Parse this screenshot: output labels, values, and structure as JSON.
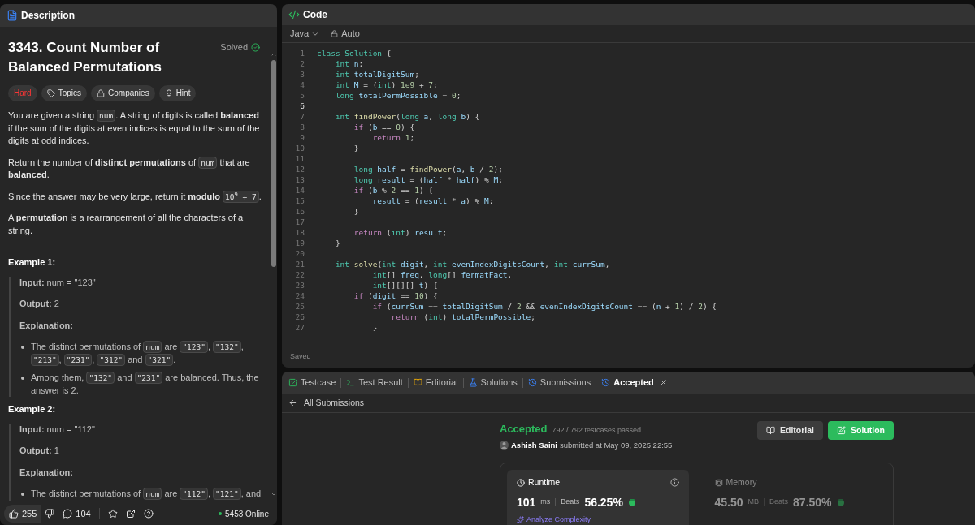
{
  "description": {
    "tab": "Description",
    "title": "3343. Count Number of Balanced Permutations",
    "status": "Solved",
    "solved": true,
    "tags": [
      {
        "label": "Hard",
        "kind": "difficulty"
      },
      {
        "label": "Topics",
        "kind": "topics"
      },
      {
        "label": "Companies",
        "kind": "companies"
      },
      {
        "label": "Hint",
        "kind": "hint"
      }
    ],
    "paragraphs": [
      [
        {
          "t": "You are given a string ",
          "kind": "text"
        },
        {
          "t": "num",
          "kind": "code"
        },
        {
          "t": ". A string of digits is called **balanced** if the sum of the digits at even indices is equal to the sum of the digits at odd indices.",
          "kind": "text"
        }
      ],
      [
        {
          "t": "Return the number of **distinct permutations** of ",
          "kind": "text"
        },
        {
          "t": "num",
          "kind": "code"
        },
        {
          "t": " that are **balanced**.",
          "kind": "text"
        }
      ],
      [
        {
          "t": "Since the answer may be very large, return it **modulo** ",
          "kind": "text"
        },
        {
          "t": "10$^{9}$ + 7",
          "kind": "code"
        },
        {
          "t": ".",
          "kind": "text"
        }
      ],
      [
        {
          "t": "A **permutation** is a rearrangement of all the characters of a string.",
          "kind": "text"
        }
      ]
    ],
    "examples": [
      {
        "heading": "Example 1:",
        "input": "**Input:** num = \"123\"",
        "output": "**Output:** 2",
        "explanation": "Explanation:",
        "bullets": [
          [
            {
              "t": "The distinct permutations of ",
              "kind": "text"
            },
            {
              "t": "num",
              "kind": "code"
            },
            {
              "t": " are ",
              "kind": "text"
            },
            {
              "t": "\"123\"",
              "kind": "code"
            },
            {
              "t": ", ",
              "kind": "text"
            },
            {
              "t": "\"132\"",
              "kind": "code"
            },
            {
              "t": ", ",
              "kind": "text"
            },
            {
              "t": "\"213\"",
              "kind": "code"
            },
            {
              "t": ", ",
              "kind": "text"
            },
            {
              "t": "\"231\"",
              "kind": "code"
            },
            {
              "t": ", ",
              "kind": "text"
            },
            {
              "t": "\"312\"",
              "kind": "code"
            },
            {
              "t": " and ",
              "kind": "text"
            },
            {
              "t": "\"321\"",
              "kind": "code"
            },
            {
              "t": ".",
              "kind": "text"
            }
          ],
          [
            {
              "t": "Among them, ",
              "kind": "text"
            },
            {
              "t": "\"132\"",
              "kind": "code"
            },
            {
              "t": " and ",
              "kind": "text"
            },
            {
              "t": "\"231\"",
              "kind": "code"
            },
            {
              "t": " are balanced. Thus, the answer is 2.",
              "kind": "text"
            }
          ]
        ]
      },
      {
        "heading": "Example 2:",
        "input": "**Input:** num = \"112\"",
        "output": "**Output:** 1",
        "explanation": "Explanation:",
        "bullets": [
          [
            {
              "t": "The distinct permutations of ",
              "kind": "text"
            },
            {
              "t": "num",
              "kind": "code"
            },
            {
              "t": " are ",
              "kind": "text"
            },
            {
              "t": "\"112\"",
              "kind": "code"
            },
            {
              "t": ", ",
              "kind": "text"
            },
            {
              "t": "\"121\"",
              "kind": "code"
            },
            {
              "t": ", and",
              "kind": "text"
            }
          ]
        ]
      }
    ],
    "footer": {
      "likes": "255",
      "comments": "104",
      "online": "5453 Online"
    }
  },
  "code": {
    "tab": "Code",
    "language": "Java",
    "mode": "Auto",
    "status": "Saved",
    "lines": [
      {
        "number": "1",
        "active": false,
        "tokens": [
          {
            "t": "class ",
            "kind": "kw"
          },
          {
            "t": "Solution",
            "kind": "cls"
          },
          {
            "t": " {",
            "kind": "p"
          }
        ]
      },
      {
        "number": "2",
        "active": false,
        "tokens": [
          {
            "t": "    int ",
            "kind": "kw"
          },
          {
            "t": "n",
            "kind": "var"
          },
          {
            "t": ";",
            "kind": "p"
          }
        ]
      },
      {
        "number": "3",
        "active": false,
        "tokens": [
          {
            "t": "    int ",
            "kind": "kw"
          },
          {
            "t": "totalDigitSum",
            "kind": "var"
          },
          {
            "t": ";",
            "kind": "p"
          }
        ]
      },
      {
        "number": "4",
        "active": false,
        "tokens": [
          {
            "t": "    int ",
            "kind": "kw"
          },
          {
            "t": "M",
            "kind": "var"
          },
          {
            "t": " = (",
            "kind": "p"
          },
          {
            "t": "int",
            "kind": "kw"
          },
          {
            "t": ") ",
            "kind": "p"
          },
          {
            "t": "1e9",
            "kind": "num"
          },
          {
            "t": " + ",
            "kind": "p"
          },
          {
            "t": "7",
            "kind": "num"
          },
          {
            "t": ";",
            "kind": "p"
          }
        ]
      },
      {
        "number": "5",
        "active": false,
        "tokens": [
          {
            "t": "    long ",
            "kind": "kw"
          },
          {
            "t": "totalPermPossible",
            "kind": "var"
          },
          {
            "t": " = ",
            "kind": "p"
          },
          {
            "t": "0",
            "kind": "num"
          },
          {
            "t": ";",
            "kind": "p"
          }
        ]
      },
      {
        "number": "6",
        "active": true
      },
      {
        "number": "7",
        "active": false,
        "tokens": [
          {
            "t": "    int ",
            "kind": "kw"
          },
          {
            "t": "findPower",
            "kind": "fn"
          },
          {
            "t": "(",
            "kind": "p"
          },
          {
            "t": "long ",
            "kind": "kw"
          },
          {
            "t": "a",
            "kind": "var"
          },
          {
            "t": ", ",
            "kind": "p"
          },
          {
            "t": "long ",
            "kind": "kw"
          },
          {
            "t": "b",
            "kind": "var"
          },
          {
            "t": ") {",
            "kind": "p"
          }
        ]
      },
      {
        "number": "8",
        "active": false,
        "tokens": [
          {
            "t": "        if ",
            "kind": "ctrl"
          },
          {
            "t": "(",
            "kind": "p"
          },
          {
            "t": "b",
            "kind": "var"
          },
          {
            "t": " == ",
            "kind": "p"
          },
          {
            "t": "0",
            "kind": "num"
          },
          {
            "t": ") {",
            "kind": "p"
          }
        ]
      },
      {
        "number": "9",
        "active": false,
        "tokens": [
          {
            "t": "            return ",
            "kind": "ctrl"
          },
          {
            "t": "1",
            "kind": "num"
          },
          {
            "t": ";",
            "kind": "p"
          }
        ]
      },
      {
        "number": "10",
        "active": false,
        "tokens": [
          {
            "t": "        }",
            "kind": "p"
          }
        ]
      },
      {
        "number": "11",
        "active": false
      },
      {
        "number": "12",
        "active": false,
        "tokens": [
          {
            "t": "        long ",
            "kind": "kw"
          },
          {
            "t": "half",
            "kind": "var"
          },
          {
            "t": " = ",
            "kind": "p"
          },
          {
            "t": "findPower",
            "kind": "fn"
          },
          {
            "t": "(",
            "kind": "p"
          },
          {
            "t": "a",
            "kind": "var"
          },
          {
            "t": ", ",
            "kind": "p"
          },
          {
            "t": "b",
            "kind": "var"
          },
          {
            "t": " / ",
            "kind": "p"
          },
          {
            "t": "2",
            "kind": "num"
          },
          {
            "t": ");",
            "kind": "p"
          }
        ]
      },
      {
        "number": "13",
        "active": false,
        "tokens": [
          {
            "t": "        long ",
            "kind": "kw"
          },
          {
            "t": "result",
            "kind": "var"
          },
          {
            "t": " = (",
            "kind": "p"
          },
          {
            "t": "half",
            "kind": "var"
          },
          {
            "t": " * ",
            "kind": "p"
          },
          {
            "t": "half",
            "kind": "var"
          },
          {
            "t": ") % ",
            "kind": "p"
          },
          {
            "t": "M",
            "kind": "var"
          },
          {
            "t": ";",
            "kind": "p"
          }
        ]
      },
      {
        "number": "14",
        "active": false,
        "tokens": [
          {
            "t": "        if ",
            "kind": "ctrl"
          },
          {
            "t": "(",
            "kind": "p"
          },
          {
            "t": "b",
            "kind": "var"
          },
          {
            "t": " % ",
            "kind": "p"
          },
          {
            "t": "2",
            "kind": "num"
          },
          {
            "t": " == ",
            "kind": "p"
          },
          {
            "t": "1",
            "kind": "num"
          },
          {
            "t": ") {",
            "kind": "p"
          }
        ]
      },
      {
        "number": "15",
        "active": false,
        "tokens": [
          {
            "t": "            result",
            "kind": "var"
          },
          {
            "t": " = (",
            "kind": "p"
          },
          {
            "t": "result",
            "kind": "var"
          },
          {
            "t": " * ",
            "kind": "p"
          },
          {
            "t": "a",
            "kind": "var"
          },
          {
            "t": ") % ",
            "kind": "p"
          },
          {
            "t": "M",
            "kind": "var"
          },
          {
            "t": ";",
            "kind": "p"
          }
        ]
      },
      {
        "number": "16",
        "active": false,
        "tokens": [
          {
            "t": "        }",
            "kind": "p"
          }
        ]
      },
      {
        "number": "17",
        "active": false
      },
      {
        "number": "18",
        "active": false,
        "tokens": [
          {
            "t": "        return ",
            "kind": "ctrl"
          },
          {
            "t": "(",
            "kind": "p"
          },
          {
            "t": "int",
            "kind": "kw"
          },
          {
            "t": ") ",
            "kind": "p"
          },
          {
            "t": "result",
            "kind": "var"
          },
          {
            "t": ";",
            "kind": "p"
          }
        ]
      },
      {
        "number": "19",
        "active": false,
        "tokens": [
          {
            "t": "    }",
            "kind": "p"
          }
        ]
      },
      {
        "number": "20",
        "active": false
      },
      {
        "number": "21",
        "active": false,
        "tokens": [
          {
            "t": "    int ",
            "kind": "kw"
          },
          {
            "t": "solve",
            "kind": "fn"
          },
          {
            "t": "(",
            "kind": "p"
          },
          {
            "t": "int ",
            "kind": "kw"
          },
          {
            "t": "digit",
            "kind": "var"
          },
          {
            "t": ", ",
            "kind": "p"
          },
          {
            "t": "int ",
            "kind": "kw"
          },
          {
            "t": "evenIndexDigitsCount",
            "kind": "var"
          },
          {
            "t": ", ",
            "kind": "p"
          },
          {
            "t": "int ",
            "kind": "kw"
          },
          {
            "t": "currSum",
            "kind": "var"
          },
          {
            "t": ",",
            "kind": "p"
          }
        ]
      },
      {
        "number": "22",
        "active": false,
        "tokens": [
          {
            "t": "            int",
            "kind": "kw"
          },
          {
            "t": "[] ",
            "kind": "p"
          },
          {
            "t": "freq",
            "kind": "var"
          },
          {
            "t": ", ",
            "kind": "p"
          },
          {
            "t": "long",
            "kind": "kw"
          },
          {
            "t": "[] ",
            "kind": "p"
          },
          {
            "t": "fermatFact",
            "kind": "var"
          },
          {
            "t": ",",
            "kind": "p"
          }
        ]
      },
      {
        "number": "23",
        "active": false,
        "tokens": [
          {
            "t": "            int",
            "kind": "kw"
          },
          {
            "t": "[][][] ",
            "kind": "p"
          },
          {
            "t": "t",
            "kind": "var"
          },
          {
            "t": ") {",
            "kind": "p"
          }
        ]
      },
      {
        "number": "24",
        "active": false,
        "tokens": [
          {
            "t": "        if ",
            "kind": "ctrl"
          },
          {
            "t": "(",
            "kind": "p"
          },
          {
            "t": "digit",
            "kind": "var"
          },
          {
            "t": " == ",
            "kind": "p"
          },
          {
            "t": "10",
            "kind": "num"
          },
          {
            "t": ") {",
            "kind": "p"
          }
        ]
      },
      {
        "number": "25",
        "active": false,
        "tokens": [
          {
            "t": "            if ",
            "kind": "ctrl"
          },
          {
            "t": "(",
            "kind": "p"
          },
          {
            "t": "currSum",
            "kind": "var"
          },
          {
            "t": " == ",
            "kind": "p"
          },
          {
            "t": "totalDigitSum",
            "kind": "var"
          },
          {
            "t": " / ",
            "kind": "p"
          },
          {
            "t": "2",
            "kind": "num"
          },
          {
            "t": " && ",
            "kind": "p"
          },
          {
            "t": "evenIndexDigitsCount",
            "kind": "var"
          },
          {
            "t": " == (",
            "kind": "p"
          },
          {
            "t": "n",
            "kind": "var"
          },
          {
            "t": " + ",
            "kind": "p"
          },
          {
            "t": "1",
            "kind": "num"
          },
          {
            "t": ") / ",
            "kind": "p"
          },
          {
            "t": "2",
            "kind": "num"
          },
          {
            "t": ") {",
            "kind": "p"
          }
        ]
      },
      {
        "number": "26",
        "active": false,
        "tokens": [
          {
            "t": "                return ",
            "kind": "ctrl"
          },
          {
            "t": "(",
            "kind": "p"
          },
          {
            "t": "int",
            "kind": "kw"
          },
          {
            "t": ") ",
            "kind": "p"
          },
          {
            "t": "totalPermPossible",
            "kind": "var"
          },
          {
            "t": ";",
            "kind": "p"
          }
        ]
      },
      {
        "number": "27",
        "active": false,
        "tokens": [
          {
            "t": "            }",
            "kind": "p"
          }
        ]
      }
    ]
  },
  "result": {
    "tabs": [
      {
        "label": "Testcase",
        "kind": "testcase",
        "selected": false
      },
      {
        "label": "Test Result",
        "kind": "terminal",
        "selected": false
      },
      {
        "label": "Editorial",
        "kind": "book",
        "selected": false
      },
      {
        "label": "Solutions",
        "kind": "flask",
        "selected": false
      },
      {
        "label": "Submissions",
        "kind": "history",
        "selected": false
      },
      {
        "label": "Accepted",
        "kind": "history",
        "selected": true
      }
    ],
    "back": "All Submissions",
    "verdict": "Accepted",
    "passed": "792 / 792 testcases passed",
    "author": "Ashish Saini",
    "submitted": "submitted at May 09, 2025 22:55",
    "buttons": [
      {
        "label": "Editorial",
        "kind": "secondary"
      },
      {
        "label": "Solution",
        "kind": "primary"
      }
    ],
    "stats": [
      {
        "title": "Runtime",
        "value": "101",
        "unit": "ms",
        "beats": "Beats",
        "percent": "56.25%",
        "selected": true,
        "analyze": "Analyze Complexity"
      },
      {
        "title": "Memory",
        "value": "45.50",
        "unit": "MB",
        "beats": "Beats",
        "percent": "87.50%",
        "selected": false
      }
    ]
  }
}
